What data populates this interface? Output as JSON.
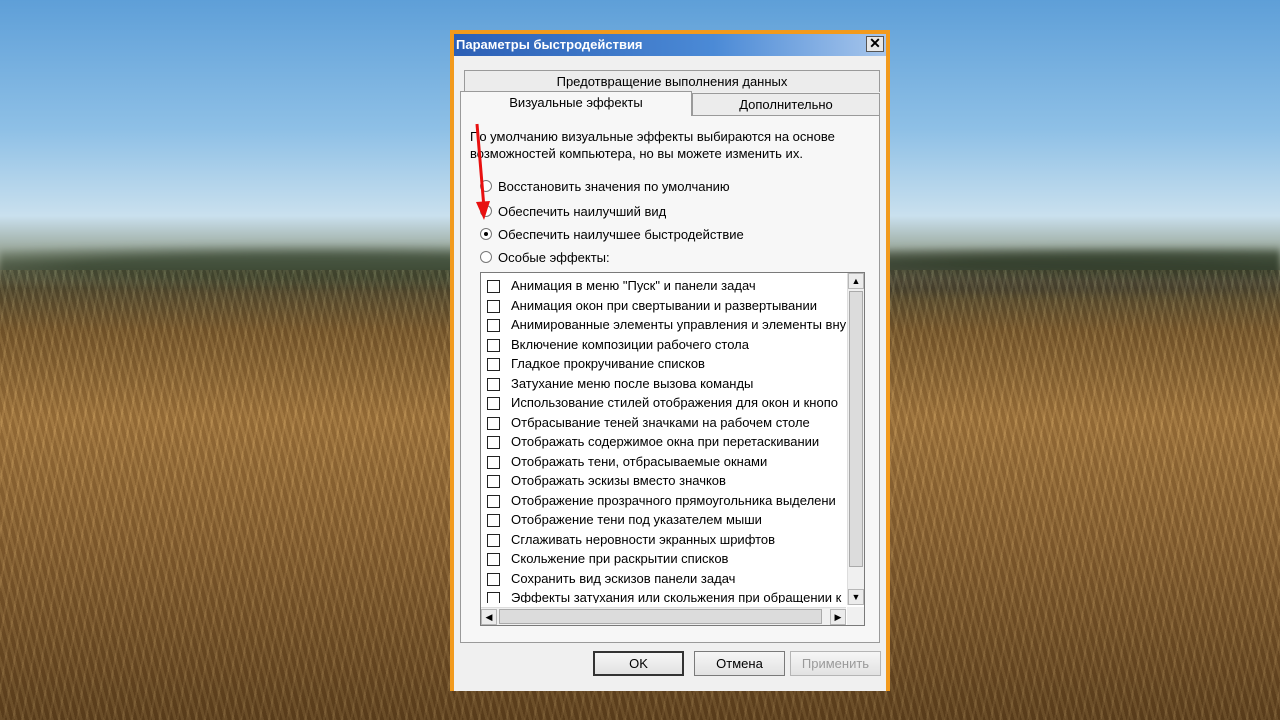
{
  "dialog": {
    "title": "Параметры быстродействия",
    "close_glyph": "✕"
  },
  "tabs": [
    {
      "label": "Предотвращение выполнения данных"
    },
    {
      "label": "Визуальные эффекты",
      "active": true
    },
    {
      "label": "Дополнительно"
    }
  ],
  "description": "По умолчанию визуальные эффекты выбираются на основе возможностей компьютера, но вы можете изменить их.",
  "radios": [
    {
      "label": "Восстановить значения по умолчанию",
      "selected": false
    },
    {
      "label": "Обеспечить наилучший вид",
      "selected": false
    },
    {
      "label": "Обеспечить наилучшее быстродействие",
      "selected": true
    },
    {
      "label": "Особые эффекты:",
      "selected": false
    }
  ],
  "effects": [
    {
      "label": "Анимация в меню \"Пуск\" и панели задач",
      "checked": false
    },
    {
      "label": "Анимация окон при свертывании и развертывании",
      "checked": false
    },
    {
      "label": "Анимированные элементы управления и элементы вну",
      "checked": false
    },
    {
      "label": "Включение композиции рабочего стола",
      "checked": false
    },
    {
      "label": "Гладкое прокручивание списков",
      "checked": false
    },
    {
      "label": "Затухание меню после вызова команды",
      "checked": false
    },
    {
      "label": "Использование стилей отображения для окон и кнопо",
      "checked": false
    },
    {
      "label": "Отбрасывание теней значками на рабочем столе",
      "checked": false
    },
    {
      "label": "Отображать содержимое окна при перетаскивании",
      "checked": false
    },
    {
      "label": "Отображать тени, отбрасываемые окнами",
      "checked": false
    },
    {
      "label": "Отображать эскизы вместо значков",
      "checked": false
    },
    {
      "label": "Отображение прозрачного прямоугольника выделени",
      "checked": false
    },
    {
      "label": "Отображение тени под указателем мыши",
      "checked": false
    },
    {
      "label": "Сглаживать неровности экранных шрифтов",
      "checked": false
    },
    {
      "label": "Скольжение при раскрытии списков",
      "checked": false
    },
    {
      "label": "Сохранить вид эскизов панели задач",
      "checked": false
    },
    {
      "label": "Эффекты затухания или скольжения при обращении к",
      "checked": false
    }
  ],
  "buttons": {
    "ok": "OK",
    "cancel": "Отмена",
    "apply": "Применить"
  },
  "colors": {
    "highlight_border": "#f29a1c",
    "arrow": "#e81010",
    "titlebar": "#2c5fb5"
  },
  "icons": {
    "scroll_up": "▲",
    "scroll_down": "▼",
    "scroll_left": "◀",
    "scroll_right": "▶"
  }
}
